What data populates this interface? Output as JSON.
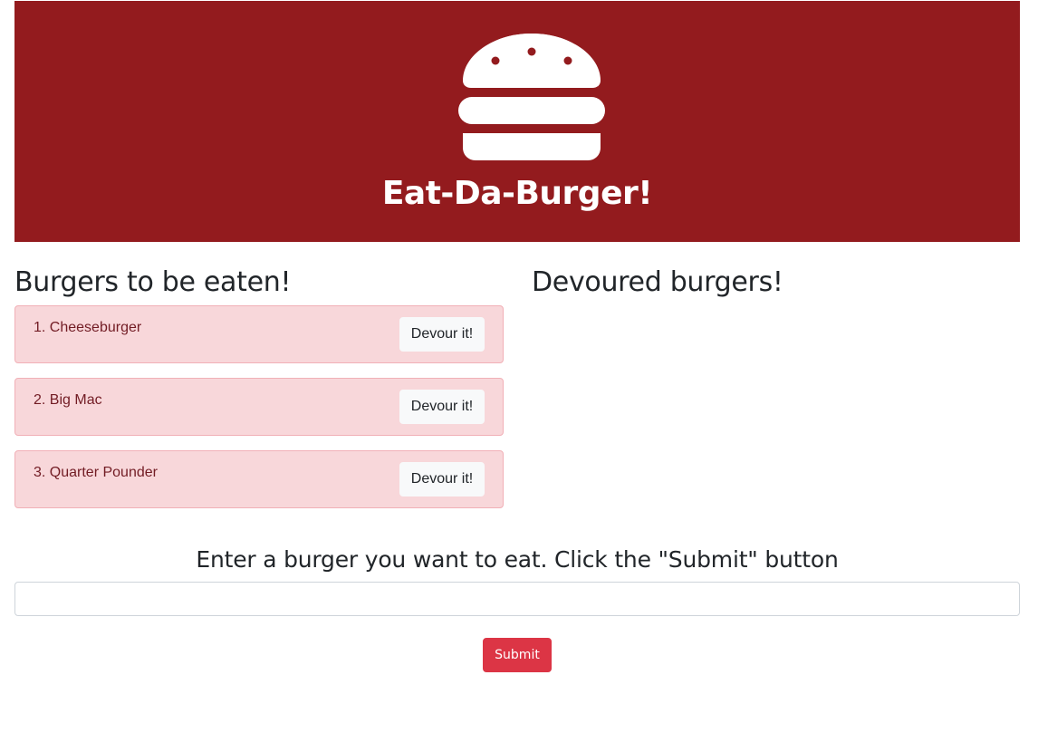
{
  "header": {
    "logo_icon": "burger-icon",
    "title": "Eat-Da-Burger!",
    "background_color": "#931b1e"
  },
  "to_eat": {
    "title": "Burgers to be eaten!",
    "items": [
      {
        "label": "1. Cheeseburger",
        "button": "Devour it!"
      },
      {
        "label": "2. Big Mac",
        "button": "Devour it!"
      },
      {
        "label": "3. Quarter Pounder",
        "button": "Devour it!"
      }
    ]
  },
  "devoured": {
    "title": "Devoured burgers!",
    "items": []
  },
  "form": {
    "label": "Enter a burger you want to eat. Click the \"Submit\" button",
    "input_value": "",
    "input_placeholder": "",
    "submit_label": "Submit",
    "submit_color": "#dc3545"
  }
}
